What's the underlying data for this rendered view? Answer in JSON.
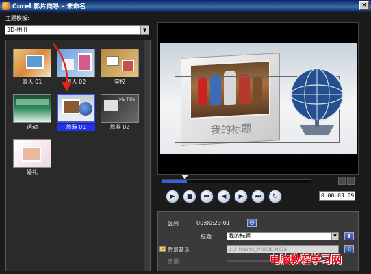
{
  "window": {
    "title": "Corel 影片向导 - 未命名",
    "close_glyph": "×"
  },
  "theme": {
    "label": "主题模板:",
    "selected": "3D-相册"
  },
  "templates": [
    {
      "label": "家人 01"
    },
    {
      "label": "家人 02"
    },
    {
      "label": "学校"
    },
    {
      "label": "运动"
    },
    {
      "label": "旅游 01",
      "selected": true
    },
    {
      "label": "旅游 02"
    },
    {
      "label": "婚礼"
    }
  ],
  "preview": {
    "title_text": "我的标题"
  },
  "playback": {
    "timecode": "0:00:03.09",
    "progress_fraction": 0.17,
    "buttons": [
      {
        "name": "play-button",
        "glyph": "▶"
      },
      {
        "name": "stop-button",
        "glyph": "■"
      },
      {
        "name": "go-to-start-button",
        "glyph": "⏮"
      },
      {
        "name": "previous-frame-button",
        "glyph": "◀"
      },
      {
        "name": "next-frame-button",
        "glyph": "▶"
      },
      {
        "name": "go-to-end-button",
        "glyph": "⏭"
      },
      {
        "name": "repeat-button",
        "glyph": "↻"
      }
    ]
  },
  "properties": {
    "duration_label": "区间:",
    "duration_value": "00:00:23:01",
    "title_label": "标题:",
    "title_value": "我的标题",
    "music_label": "背景音乐:",
    "music_value": "3D-Travel_music.mpa",
    "music_checked": true,
    "volume_label": "音量:"
  },
  "watermark": "电脑教程学习网",
  "colors": {
    "selection": "#2233ee",
    "accent_arrow": "#e2231a"
  }
}
